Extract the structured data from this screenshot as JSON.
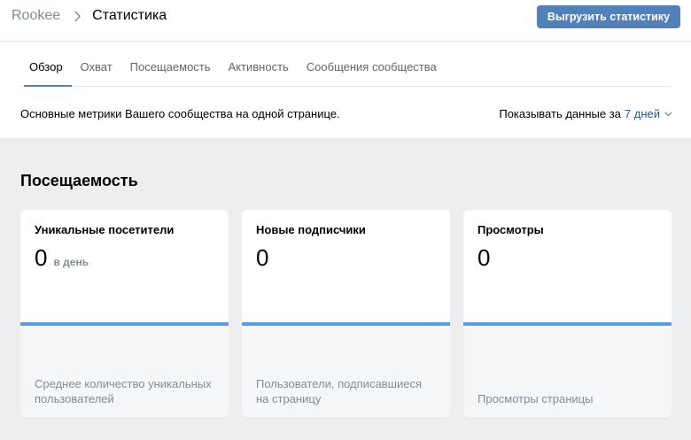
{
  "breadcrumb": {
    "root": "Rookee",
    "current": "Статистика"
  },
  "toolbar": {
    "export_label": "Выгрузить статистику"
  },
  "tabs": [
    {
      "label": "Обзор",
      "active": true
    },
    {
      "label": "Охват"
    },
    {
      "label": "Посещаемость"
    },
    {
      "label": "Активность"
    },
    {
      "label": "Сообщения сообщества"
    }
  ],
  "subtitle": "Основные метрики Вашего сообщества на одной странице.",
  "period": {
    "label": "Показывать данные за",
    "value": "7 дней"
  },
  "section_title": "Посещаемость",
  "cards": [
    {
      "title": "Уникальные посетители",
      "value": "0",
      "unit": "в день",
      "description": "Среднее количество уникальных пользователей"
    },
    {
      "title": "Новые подписчики",
      "value": "0",
      "unit": "",
      "description": "Пользователи, подписавшиеся на страницу"
    },
    {
      "title": "Просмотры",
      "value": "0",
      "unit": "",
      "description": "Просмотры страницы"
    }
  ],
  "colors": {
    "accent": "#5181b8",
    "link": "#2a5885",
    "bar": "#5e9ce0",
    "muted": "#818c99",
    "background": "#edeef0"
  }
}
